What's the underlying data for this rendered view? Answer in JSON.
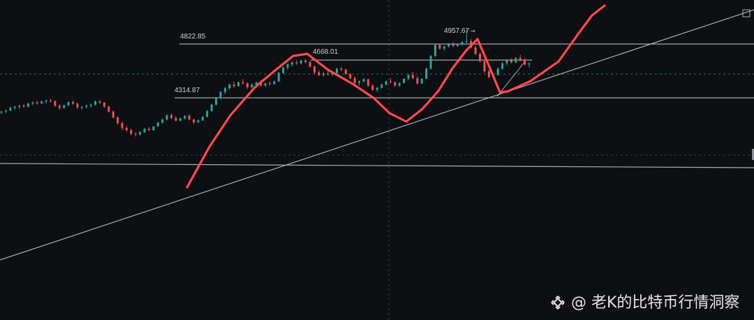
{
  "chart_data": {
    "type": "candlestick",
    "price_annotations": [
      "4822.85",
      "4668.01",
      "4957.67",
      "4314.87"
    ],
    "horizontal_levels": [
      4822.85,
      4668.01,
      4314.87
    ],
    "candles": [
      [
        4175,
        4190,
        4160,
        4185
      ],
      [
        4185,
        4205,
        4170,
        4195
      ],
      [
        4195,
        4230,
        4190,
        4220
      ],
      [
        4220,
        4240,
        4200,
        4230
      ],
      [
        4230,
        4250,
        4210,
        4240
      ],
      [
        4240,
        4255,
        4220,
        4232
      ],
      [
        4232,
        4270,
        4225,
        4260
      ],
      [
        4260,
        4280,
        4245,
        4270
      ],
      [
        4270,
        4285,
        4250,
        4262
      ],
      [
        4262,
        4290,
        4255,
        4280
      ],
      [
        4280,
        4300,
        4260,
        4290
      ],
      [
        4290,
        4305,
        4270,
        4285
      ],
      [
        4285,
        4290,
        4230,
        4240
      ],
      [
        4240,
        4255,
        4200,
        4220
      ],
      [
        4220,
        4250,
        4210,
        4245
      ],
      [
        4245,
        4280,
        4235,
        4275
      ],
      [
        4275,
        4290,
        4250,
        4260
      ],
      [
        4260,
        4270,
        4210,
        4225
      ],
      [
        4225,
        4240,
        4200,
        4230
      ],
      [
        4230,
        4250,
        4215,
        4240
      ],
      [
        4240,
        4260,
        4220,
        4250
      ],
      [
        4250,
        4290,
        4240,
        4282
      ],
      [
        4282,
        4295,
        4260,
        4270
      ],
      [
        4270,
        4275,
        4220,
        4232
      ],
      [
        4232,
        4240,
        4175,
        4185
      ],
      [
        4185,
        4195,
        4120,
        4130
      ],
      [
        4130,
        4140,
        4060,
        4075
      ],
      [
        4075,
        4090,
        4010,
        4030
      ],
      [
        4030,
        4050,
        3995,
        4010
      ],
      [
        4010,
        4025,
        3960,
        3975
      ],
      [
        3975,
        3990,
        3950,
        3968
      ],
      [
        3968,
        4000,
        3960,
        3990
      ],
      [
        3990,
        4030,
        3985,
        4020
      ],
      [
        4020,
        4040,
        4000,
        4010
      ],
      [
        4010,
        4050,
        4005,
        4045
      ],
      [
        4045,
        4090,
        4040,
        4080
      ],
      [
        4080,
        4120,
        4070,
        4110
      ],
      [
        4110,
        4160,
        4100,
        4150
      ],
      [
        4150,
        4170,
        4110,
        4125
      ],
      [
        4125,
        4140,
        4090,
        4100
      ],
      [
        4100,
        4130,
        4090,
        4120
      ],
      [
        4120,
        4150,
        4110,
        4145
      ],
      [
        4145,
        4160,
        4100,
        4110
      ],
      [
        4110,
        4120,
        4070,
        4085
      ],
      [
        4085,
        4110,
        4075,
        4102
      ],
      [
        4102,
        4140,
        4095,
        4135
      ],
      [
        4135,
        4200,
        4130,
        4190
      ],
      [
        4190,
        4260,
        4185,
        4250
      ],
      [
        4250,
        4320,
        4240,
        4310
      ],
      [
        4310,
        4380,
        4300,
        4370
      ],
      [
        4370,
        4420,
        4350,
        4405
      ],
      [
        4405,
        4450,
        4390,
        4440
      ],
      [
        4440,
        4470,
        4410,
        4425
      ],
      [
        4425,
        4470,
        4420,
        4462
      ],
      [
        4462,
        4490,
        4440,
        4450
      ],
      [
        4450,
        4460,
        4400,
        4415
      ],
      [
        4415,
        4450,
        4405,
        4440
      ],
      [
        4440,
        4470,
        4425,
        4460
      ],
      [
        4460,
        4480,
        4420,
        4432
      ],
      [
        4432,
        4460,
        4415,
        4450
      ],
      [
        4450,
        4470,
        4430,
        4445
      ],
      [
        4445,
        4480,
        4440,
        4470
      ],
      [
        4470,
        4560,
        4465,
        4550
      ],
      [
        4550,
        4610,
        4540,
        4600
      ],
      [
        4600,
        4640,
        4580,
        4630
      ],
      [
        4630,
        4660,
        4610,
        4648
      ],
      [
        4648,
        4670,
        4625,
        4640
      ],
      [
        4640,
        4675,
        4630,
        4668
      ],
      [
        4668,
        4680,
        4640,
        4652
      ],
      [
        4652,
        4665,
        4600,
        4610
      ],
      [
        4610,
        4620,
        4540,
        4555
      ],
      [
        4555,
        4575,
        4520,
        4530
      ],
      [
        4530,
        4560,
        4515,
        4545
      ],
      [
        4545,
        4570,
        4525,
        4535
      ],
      [
        4535,
        4560,
        4520,
        4550
      ],
      [
        4550,
        4600,
        4545,
        4590
      ],
      [
        4590,
        4610,
        4570,
        4580
      ],
      [
        4580,
        4590,
        4530,
        4540
      ],
      [
        4540,
        4550,
        4490,
        4500
      ],
      [
        4500,
        4520,
        4440,
        4455
      ],
      [
        4455,
        4480,
        4430,
        4470
      ],
      [
        4470,
        4500,
        4460,
        4490
      ],
      [
        4490,
        4495,
        4420,
        4430
      ],
      [
        4430,
        4445,
        4380,
        4390
      ],
      [
        4390,
        4420,
        4370,
        4410
      ],
      [
        4410,
        4450,
        4400,
        4440
      ],
      [
        4440,
        4480,
        4430,
        4470
      ],
      [
        4470,
        4500,
        4450,
        4462
      ],
      [
        4462,
        4470,
        4420,
        4430
      ],
      [
        4430,
        4460,
        4420,
        4455
      ],
      [
        4455,
        4500,
        4450,
        4495
      ],
      [
        4495,
        4540,
        4480,
        4530
      ],
      [
        4530,
        4560,
        4490,
        4500
      ],
      [
        4500,
        4520,
        4440,
        4450
      ],
      [
        4450,
        4500,
        4445,
        4495
      ],
      [
        4495,
        4600,
        4490,
        4590
      ],
      [
        4590,
        4720,
        4580,
        4710
      ],
      [
        4710,
        4830,
        4700,
        4815
      ],
      [
        4815,
        4830,
        4770,
        4780
      ],
      [
        4780,
        4810,
        4760,
        4800
      ],
      [
        4800,
        4830,
        4790,
        4820
      ],
      [
        4820,
        4840,
        4795,
        4805
      ],
      [
        4805,
        4830,
        4795,
        4825
      ],
      [
        4825,
        4850,
        4805,
        4840
      ],
      [
        4840,
        4958,
        4830,
        4850
      ],
      [
        4850,
        4870,
        4780,
        4790
      ],
      [
        4790,
        4810,
        4720,
        4730
      ],
      [
        4730,
        4745,
        4650,
        4660
      ],
      [
        4660,
        4680,
        4550,
        4565
      ],
      [
        4565,
        4580,
        4500,
        4510
      ],
      [
        4510,
        4540,
        4490,
        4530
      ],
      [
        4530,
        4600,
        4525,
        4590
      ],
      [
        4590,
        4650,
        4580,
        4640
      ],
      [
        4640,
        4680,
        4620,
        4668
      ],
      [
        4668,
        4690,
        4640,
        4650
      ],
      [
        4650,
        4700,
        4640,
        4690
      ],
      [
        4690,
        4720,
        4660,
        4672
      ],
      [
        4672,
        4690,
        4620,
        4630
      ],
      [
        4630,
        4650,
        4600,
        4640
      ]
    ]
  },
  "watermark": {
    "text": "@ 老K的比特币行情洞察",
    "logo": "binance-logo"
  },
  "colors": {
    "background": "#0e0f13",
    "up": "#26a69a",
    "down": "#ef5350",
    "drawing": "#ff4a4f",
    "level_line": "#c8cbd2",
    "trend_line": "#a9adb5"
  }
}
